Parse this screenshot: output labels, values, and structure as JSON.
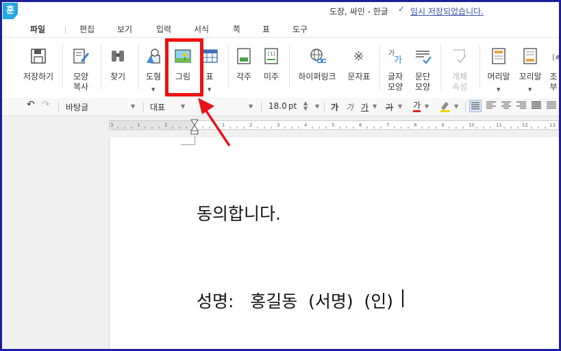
{
  "titlebar": {
    "logo": "훈",
    "doc_title": "도장, 싸인 - 한글",
    "saved_status": "임시 저장되었습니다."
  },
  "menu": [
    "파일",
    "편집",
    "보기",
    "입력",
    "서식",
    "쪽",
    "표",
    "도구"
  ],
  "ribbon": [
    {
      "label": "저장하기",
      "icon": "floppy-icon"
    },
    {
      "label": "모양\n복사",
      "icon": "format-painter-icon"
    },
    {
      "label": "찾기",
      "icon": "binoculars-icon"
    },
    {
      "label": "도형",
      "icon": "shapes-icon",
      "dropdown": true
    },
    {
      "label": "그림",
      "icon": "picture-icon",
      "highlighted": true
    },
    {
      "label": "표",
      "icon": "table-icon",
      "dropdown": true
    },
    {
      "label": "각주",
      "icon": "footnote-icon"
    },
    {
      "label": "미주",
      "icon": "endnote-icon"
    },
    {
      "label": "하이퍼링크",
      "icon": "hyperlink-icon"
    },
    {
      "label": "문자표",
      "icon": "special-char-icon"
    },
    {
      "label": "글자\n모양",
      "icon": "char-shape-icon"
    },
    {
      "label": "문단\n모양",
      "icon": "paragraph-shape-icon"
    },
    {
      "label": "개체\n속성",
      "icon": "object-props-icon",
      "disabled": true
    },
    {
      "label": "머리말",
      "icon": "header-icon",
      "dropdown": true
    },
    {
      "label": "꼬리말",
      "icon": "footer-icon",
      "dropdown": true
    },
    {
      "label": "조\n부",
      "icon": "field-icon"
    }
  ],
  "format": {
    "undo": "↶",
    "redo": "↷",
    "font": "바탕글",
    "style": "대표",
    "size": "18.0",
    "unit": "pt",
    "bold": "가",
    "italic": "가",
    "underline": "가",
    "strike": "가",
    "color": "가"
  },
  "ruler_labels": [
    "3",
    "1",
    "2",
    "1",
    "1",
    "2",
    "3",
    "4",
    "5",
    "6",
    "7",
    "8",
    "9",
    "10",
    "11",
    "12",
    "13"
  ],
  "document": {
    "line1": "동의합니다.",
    "line2": "성명:   홍길동  (서명)  (인)"
  },
  "colors": {
    "frame": "#1b1f9a",
    "highlight": "#f20f0f",
    "arrow": "#e8121b",
    "accent": "#27a7e4"
  }
}
